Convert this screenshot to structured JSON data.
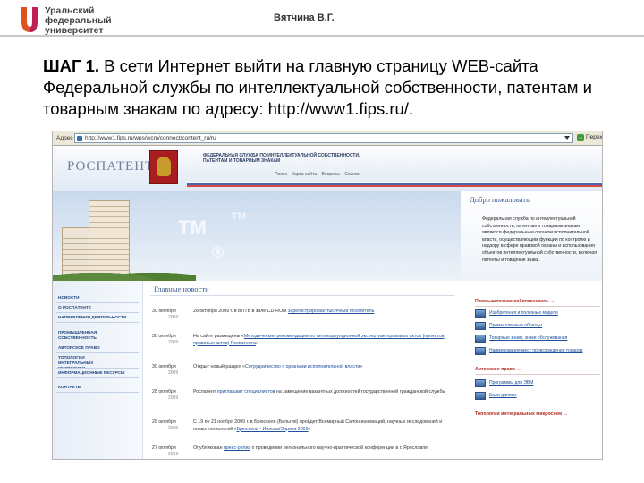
{
  "slide": {
    "logo": [
      "Уральский",
      "федеральный",
      "университет"
    ],
    "author": "Вятчина В.Г.",
    "heading_step": "ШАГ 1.",
    "heading_text": " В сети Интернет выйти на главную страницу WEB-сайта Федеральной службы по интеллектуальной собственности, патентам и товарным знакам по адресу: http://www1.fips.ru/."
  },
  "browser": {
    "address_label": "Адрес",
    "url": "http://www1.fips.ru/wps/wcm/connect/content_ru/ru",
    "go_label": "Перех"
  },
  "site": {
    "logo": "РОСПАТЕНТ",
    "title_lines": [
      "ФЕДЕРАЛЬНАЯ СЛУЖБА ПО ИНТЕЛЛЕКТУАЛЬНОЙ СОБСТВЕННОСТИ,",
      "ПАТЕНТАМ И ТОВАРНЫМ ЗНАКАМ"
    ],
    "top_links": [
      "Поиск",
      "Карта сайта",
      "Вопросы",
      "Ссылки"
    ],
    "banner_marks": [
      "TM",
      "TM",
      "®"
    ],
    "welcome_title": "Добро пожаловать",
    "welcome_text": "Федеральная служба по интеллектуальной собственности, патентам и товарным знакам является федеральным органом исполнительной власти, осуществляющим функции по контролю и надзору в сфере правовой охраны и использования объектов интеллектуальной собственности, включая патенты и товарные знаки."
  },
  "nav": [
    "НОВОСТИ",
    "О РОСПАТЕНТЕ",
    "НАПРАВЛЕНИЯ ДЕЯТЕЛЬНОСТИ",
    "ПРОМЫШЛЕННАЯ СОБСТВЕННОСТЬ",
    "АВТОРСКОЕ ПРАВО",
    "ТОПОЛОГИИ ИНТЕГРАЛЬНЫХ МИКРОСХЕМ",
    "ИНФОРМАЦИОННЫЕ РЕСУРСЫ",
    "КОНТАКТЫ"
  ],
  "news": {
    "title": "Главные новости",
    "items": [
      {
        "date": "30 октября",
        "year": "2009",
        "pre": "28 октября 2009 г. в ВПТБ в зале CD-ROM ",
        "link": "зарегистрирован тысячный посетитель",
        "post": ""
      },
      {
        "date": "30 октября",
        "year": "2009",
        "pre": "На сайте размещены «",
        "link": "Методические рекомендации по антикоррупционной экспертизе правовых актов (проектов правовых актов) Роспатента",
        "post": "»"
      },
      {
        "date": "30 октября",
        "year": "2009",
        "pre": "Открыт новый раздел «",
        "link": "Сотрудничество с органами исполнительной власти",
        "post": "»"
      },
      {
        "date": "28 октября",
        "year": "2009",
        "pre": "Роспатент ",
        "link": "приглашает специалистов",
        "post": " на замещение вакантных должностей государственной гражданской службы"
      },
      {
        "date": "28 октября",
        "year": "2009",
        "pre": "С 19 по 21 ноября 2009 г. в Брюсселе (Бельгия) пройдет Всемирный Салон инноваций, научных исследований и новых технологий «",
        "link": "Брюссель - Иннова/Эврика 2009",
        "post": "»"
      },
      {
        "date": "27 октября",
        "year": "2009",
        "pre": "Опубликован ",
        "link": "пресс-релиз",
        "post": " о проведении регионального научно-практической конференции в г. Ярославле"
      }
    ]
  },
  "right": {
    "head1": "Промышленная собственность →",
    "items1": [
      "Изобретения и полезные модели",
      "Промышленные образцы",
      "Товарные знаки, знаки обслуживания",
      "Наименования мест происхождения товаров"
    ],
    "head2": "Авторское право →",
    "items2": [
      "Программы для ЭВМ",
      "Базы данных"
    ],
    "head3": "Топологии интегральных микросхем →"
  }
}
